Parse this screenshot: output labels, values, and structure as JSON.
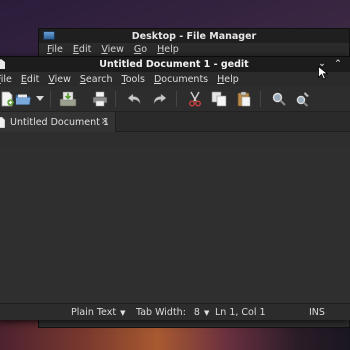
{
  "file_manager": {
    "title": "Desktop - File Manager",
    "menu": [
      "File",
      "Edit",
      "View",
      "Go",
      "Help"
    ]
  },
  "gedit": {
    "title": "Untitled Document 1 - gedit",
    "window_buttons": {
      "minimize": "⌄",
      "maximize": "⌃"
    },
    "menu": [
      "File",
      "Edit",
      "View",
      "Search",
      "Tools",
      "Documents",
      "Help"
    ],
    "toolbar_icons": [
      "new-document-icon",
      "open-icon",
      "open-dropdown-icon",
      "save-icon",
      "print-icon",
      "undo-icon",
      "redo-icon",
      "cut-icon",
      "copy-icon",
      "paste-icon",
      "find-icon",
      "find-replace-icon"
    ],
    "tab": {
      "label": "Untitled Document 1",
      "close": "×"
    },
    "statusbar": {
      "language": "Plain Text",
      "tab_width_label": "Tab Width:",
      "tab_width_value": "8",
      "position": "Ln 1, Col 1",
      "mode": "INS"
    }
  },
  "colors": {
    "window_bg": "#2e2e2e",
    "titlebar_bg": "#1c1c1c",
    "text": "#dcdcdc"
  }
}
